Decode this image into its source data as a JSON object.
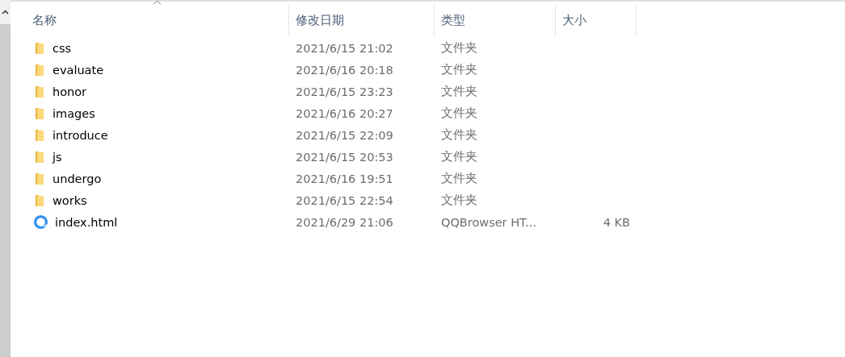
{
  "table": {
    "columns": [
      {
        "label": "名称",
        "sorted": true
      },
      {
        "label": "修改日期",
        "sorted": false
      },
      {
        "label": "类型",
        "sorted": false
      },
      {
        "label": "大小",
        "sorted": false
      }
    ],
    "rows": [
      {
        "kind": "folder",
        "name": "css",
        "date": "2021/6/15 21:02",
        "type": "文件夹"
      },
      {
        "kind": "folder",
        "name": "evaluate",
        "date": "2021/6/16 20:18",
        "type": "文件夹"
      },
      {
        "kind": "folder",
        "name": "honor",
        "date": "2021/6/15 23:23",
        "type": "文件夹"
      },
      {
        "kind": "folder",
        "name": "images",
        "date": "2021/6/16 20:27",
        "type": "文件夹"
      },
      {
        "kind": "folder",
        "name": "introduce",
        "date": "2021/6/15 22:09",
        "type": "文件夹"
      },
      {
        "kind": "folder",
        "name": "js",
        "date": "2021/6/15 20:53",
        "type": "文件夹"
      },
      {
        "kind": "folder",
        "name": "undergo",
        "date": "2021/6/16 19:51",
        "type": "文件夹"
      },
      {
        "kind": "folder",
        "name": "works",
        "date": "2021/6/15 22:54",
        "type": "文件夹"
      },
      {
        "kind": "html",
        "name": "index.html",
        "date": "2021/6/29 21:06",
        "type": "QQBrowser HT...",
        "size": "4 KB"
      }
    ]
  }
}
